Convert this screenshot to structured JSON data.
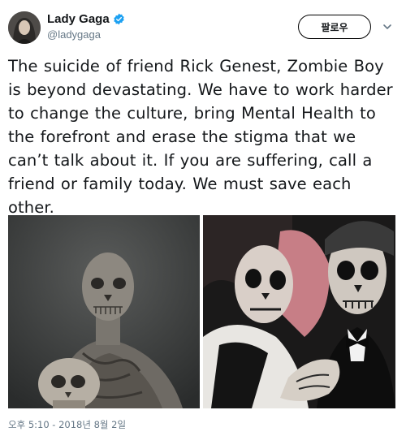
{
  "user": {
    "display_name": "Lady Gaga",
    "handle": "@ladygaga",
    "verified": true
  },
  "actions": {
    "follow_label": "팔로우",
    "menu_icon": "chevron-down-icon"
  },
  "tweet": {
    "text": "The suicide of friend Rick Genest, Zombie Boy is beyond devastating. We have to work harder to change the culture, bring Mental Health to the forefront and erase the stigma that we can’t talk about it. If you are suffering, call a friend or family today. We must save each other.",
    "timestamp": "오후 5:10 - 2018년 8월 2일"
  },
  "colors": {
    "text": "#14171a",
    "secondary": "#657786",
    "verified_blue": "#1da1f2"
  }
}
